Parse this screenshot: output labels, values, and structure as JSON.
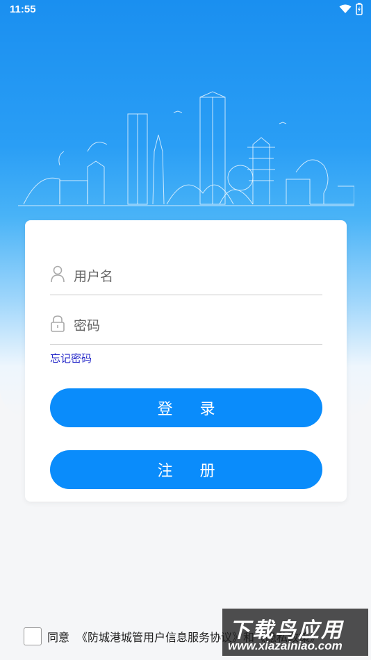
{
  "status_bar": {
    "time": "11:55"
  },
  "login": {
    "username_placeholder": "用户名",
    "password_placeholder": "密码",
    "forgot_password": "忘记密码",
    "login_button": "登 录",
    "register_button": "注 册"
  },
  "agreement": {
    "prefix": "同意",
    "link": "《防城港城管用户信息服务协议》和《隐私政策》"
  },
  "watermark": {
    "line1": "下载鸟应用",
    "line2": "www.xiazainiao.com"
  },
  "colors": {
    "primary": "#0a8cfb",
    "link": "#2326c8",
    "hero_top": "#1a8ff0"
  }
}
